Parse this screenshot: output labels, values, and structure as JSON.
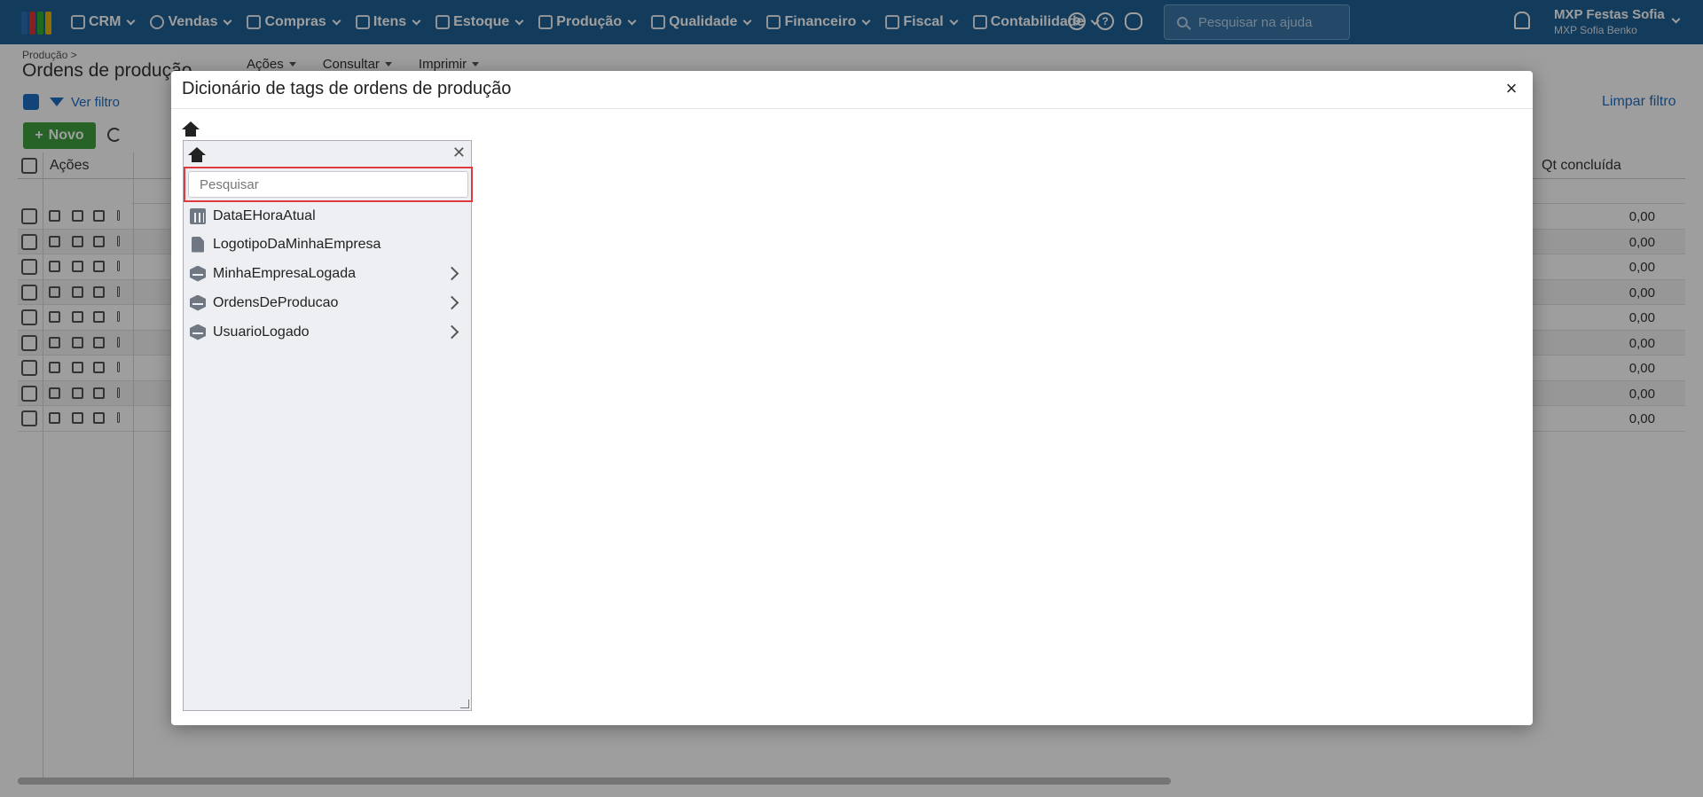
{
  "nav": {
    "items": [
      {
        "label": "CRM",
        "icon": "crm-icon"
      },
      {
        "label": "Vendas",
        "icon": "dollar-icon"
      },
      {
        "label": "Compras",
        "icon": "cart-icon"
      },
      {
        "label": "Itens",
        "icon": "items-icon"
      },
      {
        "label": "Estoque",
        "icon": "stock-icon"
      },
      {
        "label": "Produção",
        "icon": "factory-icon"
      },
      {
        "label": "Qualidade",
        "icon": "quality-icon"
      },
      {
        "label": "Financeiro",
        "icon": "finance-icon"
      },
      {
        "label": "Fiscal",
        "icon": "fiscal-icon"
      },
      {
        "label": "Contabilidade",
        "icon": "accounting-icon"
      }
    ],
    "help_search_placeholder": "Pesquisar na ajuda",
    "user_company": "MXP Festas Sofia",
    "user_name": "MXP Sofia Benko"
  },
  "page": {
    "breadcrumb": "Produção >",
    "title": "Ordens de produção",
    "toolbar": [
      "Ações",
      "Consultar",
      "Imprimir"
    ],
    "ver_filtro": "Ver filtro",
    "limpar_filtro": "Limpar filtro",
    "novo_label": "Novo",
    "col_acoes": "Ações",
    "col_qt_concluida": "Qt concluída",
    "rows": [
      "0,00",
      "0,00",
      "0,00",
      "0,00",
      "0,00",
      "0,00",
      "0,00",
      "0,00",
      "0,00"
    ]
  },
  "modal": {
    "title": "Dicionário de tags de ordens de produção",
    "search_placeholder": "Pesquisar",
    "tags": [
      {
        "label": "DataEHoraAtual",
        "icon": "calendar-icon",
        "expandable": false
      },
      {
        "label": "LogotipoDaMinhaEmpresa",
        "icon": "file-icon",
        "expandable": false
      },
      {
        "label": "MinhaEmpresaLogada",
        "icon": "cube-icon",
        "expandable": true
      },
      {
        "label": "OrdensDeProducao",
        "icon": "cube-icon",
        "expandable": true
      },
      {
        "label": "UsuarioLogado",
        "icon": "cube-icon",
        "expandable": true
      }
    ]
  },
  "colors": {
    "navbar": "#1f5f94",
    "accent_blue": "#1f6fc4",
    "novo_green": "#3f9f3f",
    "search_highlight": "#e0393e"
  }
}
